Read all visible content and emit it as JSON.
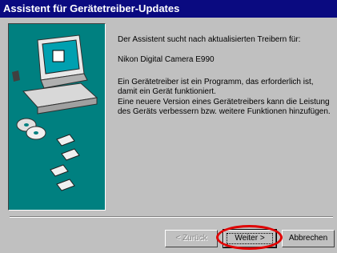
{
  "window": {
    "title": "Assistent für Gerätetreiber-Updates"
  },
  "content": {
    "line1": "Der Assistent sucht nach aktualisierten Treibern für:",
    "device": "Nikon Digital Camera E990",
    "para1": "Ein Gerätetreiber ist ein Programm, das erforderlich ist, damit ein Gerät funktioniert.",
    "para2": "Eine neuere Version eines Gerätetreibers kann die Leistung des Geräts verbessern bzw. weitere Funktionen hinzufügen."
  },
  "buttons": {
    "back": "< Zurück",
    "next": "Weiter >",
    "cancel": "Abbrechen"
  },
  "colors": {
    "titlebar": "#0a0a80",
    "illustration_bg": "#008080",
    "highlight": "#e00000"
  },
  "icons": [
    "computer-monitor-icon",
    "cd-disc-icon",
    "floppy-disk-icon"
  ]
}
